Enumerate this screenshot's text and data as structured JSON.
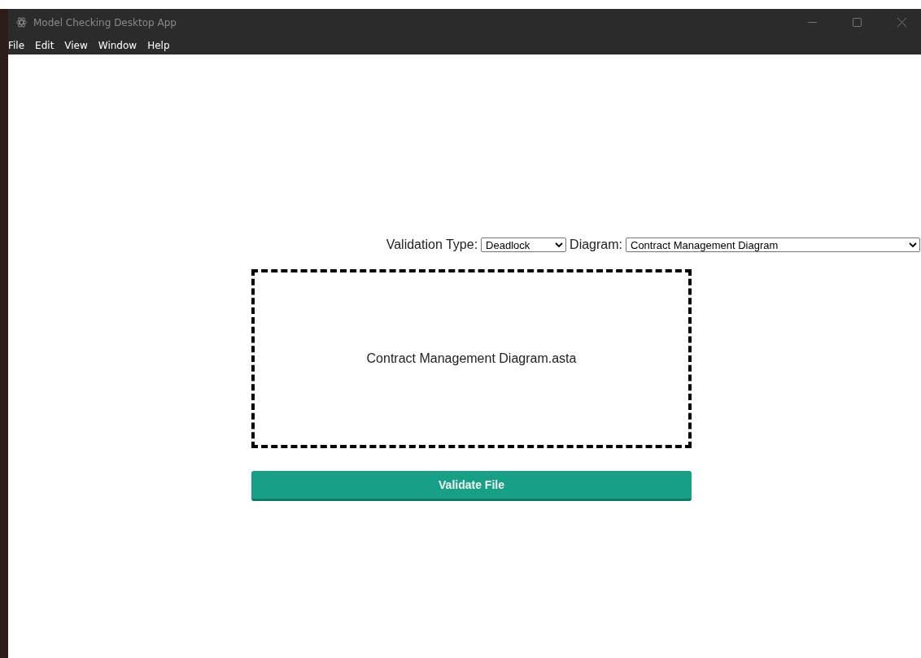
{
  "window": {
    "title": "Model Checking Desktop App"
  },
  "menu": [
    "File",
    "Edit",
    "View",
    "Window",
    "Help"
  ],
  "form": {
    "validation_type_label": "Validation Type:",
    "validation_type": "Deadlock",
    "diagram_label": "Diagram:",
    "diagram": "Contract Management Diagram"
  },
  "drop_zone": {
    "file_name": "Contract Management Diagram.asta"
  },
  "button": "Validate File"
}
